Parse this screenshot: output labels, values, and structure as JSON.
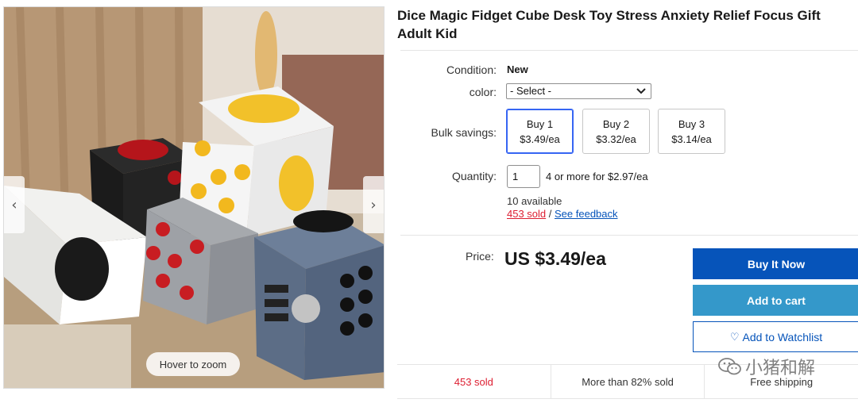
{
  "gallery": {
    "prev_glyph": "‹",
    "next_glyph": "›",
    "hover_zoom": "Hover to zoom"
  },
  "product": {
    "title": "Dice Magic Fidget Cube Desk Toy Stress Anxiety Relief Focus Gift Adult Kid"
  },
  "condition": {
    "label": "Condition:",
    "value": "New"
  },
  "color": {
    "label": "color:",
    "selected": "- Select -"
  },
  "bulk": {
    "label": "Bulk savings:",
    "options": [
      {
        "qty": "Buy 1",
        "price": "$3.49/ea"
      },
      {
        "qty": "Buy 2",
        "price": "$3.32/ea"
      },
      {
        "qty": "Buy 3",
        "price": "$3.14/ea"
      }
    ]
  },
  "quantity": {
    "label": "Quantity:",
    "value": "1",
    "note": "4 or more for $2.97/ea",
    "available": "10 available",
    "sold": "453 sold",
    "separator": " / ",
    "feedback": "See feedback"
  },
  "price": {
    "label": "Price:",
    "value": "US $3.49/ea"
  },
  "actions": {
    "buy_now": "Buy It Now",
    "add_to_cart": "Add to cart",
    "watchlist": "Add to Watchlist",
    "watch_heart": "♡"
  },
  "stats": {
    "sold": "453 sold",
    "percent": "More than 82% sold",
    "shipping": "Free shipping"
  },
  "watermark": {
    "text": "小猪和解"
  },
  "colors": {
    "primary_blue": "#0654ba",
    "cart_blue": "#3498ca",
    "sold_red": "#dd1e31",
    "selected_border": "#3665f3"
  },
  "icons": {
    "dropdown": "chevron-down-icon",
    "heart": "heart-icon",
    "wechat": "wechat-icon"
  }
}
